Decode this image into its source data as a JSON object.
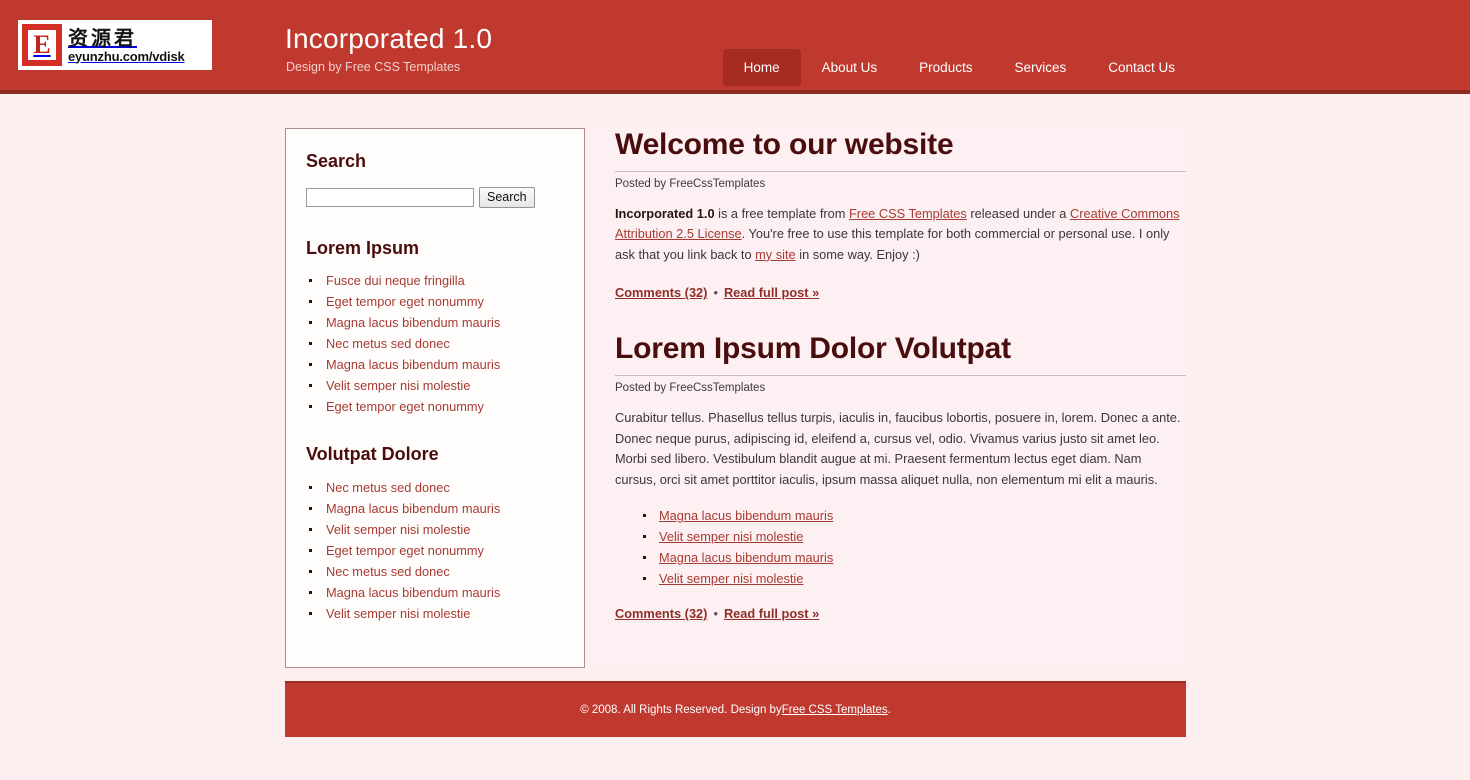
{
  "header": {
    "logo": {
      "mark_letter": "E",
      "chinese_text": "资源君",
      "url_text": "eyunzhu.com/vdisk"
    },
    "site_title": "Incorporated 1.0",
    "tagline": "Design by Free CSS Templates",
    "nav": [
      {
        "label": "Home",
        "active": true
      },
      {
        "label": "About Us",
        "active": false
      },
      {
        "label": "Products",
        "active": false
      },
      {
        "label": "Services",
        "active": false
      },
      {
        "label": "Contact Us",
        "active": false
      }
    ]
  },
  "sidebar": {
    "search": {
      "heading": "Search",
      "input_value": "",
      "placeholder": "",
      "button_label": "Search"
    },
    "sections": [
      {
        "heading": "Lorem Ipsum",
        "items": [
          "Fusce dui neque fringilla",
          "Eget tempor eget nonummy",
          "Magna lacus bibendum mauris",
          "Nec metus sed donec",
          "Magna lacus bibendum mauris",
          "Velit semper nisi molestie",
          "Eget tempor eget nonummy"
        ]
      },
      {
        "heading": "Volutpat Dolore",
        "items": [
          "Nec metus sed donec",
          "Magna lacus bibendum mauris",
          "Velit semper nisi molestie",
          "Eget tempor eget nonummy",
          "Nec metus sed donec",
          "Magna lacus bibendum mauris",
          "Velit semper nisi molestie"
        ]
      }
    ]
  },
  "main": {
    "post1": {
      "title": "Welcome to our website",
      "meta": "Posted by FreeCssTemplates",
      "body_strong": "Incorporated 1.0",
      "body_t1": " is a free template from ",
      "body_link1": "Free CSS Templates",
      "body_t2": " released under a ",
      "body_link2": "Creative Commons Attribution 2.5 License",
      "body_t3": ". You're free to use this template for both commercial or personal use. I only ask that you link back to ",
      "body_link3": "my site",
      "body_t4": " in some way. Enjoy :)",
      "comments_label": "Comments (32)",
      "separator": "•",
      "read_more_label": "Read full post »"
    },
    "post2": {
      "title": "Lorem Ipsum Dolor Volutpat",
      "meta": "Posted by FreeCssTemplates",
      "body": "Curabitur tellus. Phasellus tellus turpis, iaculis in, faucibus lobortis, posuere in, lorem. Donec a ante. Donec neque purus, adipiscing id, eleifend a, cursus vel, odio. Vivamus varius justo sit amet leo. Morbi sed libero. Vestibulum blandit augue at mi. Praesent fermentum lectus eget diam. Nam cursus, orci sit amet porttitor iaculis, ipsum massa aliquet nulla, non elementum mi elit a mauris.",
      "list": [
        "Magna lacus bibendum mauris",
        "Velit semper nisi molestie",
        "Magna lacus bibendum mauris",
        "Velit semper nisi molestie"
      ],
      "comments_label": "Comments (32)",
      "separator": "•",
      "read_more_label": "Read full post »"
    }
  },
  "footer": {
    "text_before": "© 2008. All Rights Reserved. Design by ",
    "link_label": "Free CSS Templates",
    "text_after": "."
  },
  "colors": {
    "header_red": "#c0392f",
    "header_border": "#8c2b22",
    "nav_active": "#a52a20",
    "page_bg": "#fdeef0",
    "main_bg": "#fdf0f2",
    "sidebar_bg": "#fffdfc",
    "sidebar_border": "#b08b90",
    "heading": "#4a0d0d",
    "link": "#a63b33"
  }
}
